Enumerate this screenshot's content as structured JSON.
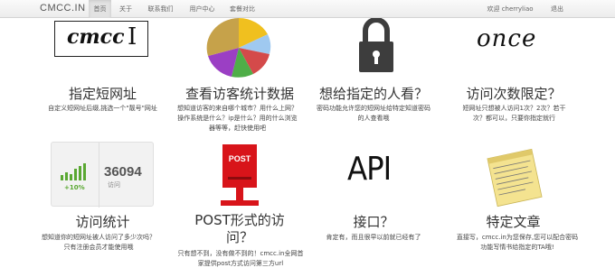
{
  "navbar": {
    "brand": "CMCC.IN",
    "items": [
      "首页",
      "关于",
      "联系我们",
      "用户中心",
      "套餐对比"
    ],
    "welcome": "欢迎 cherryliao",
    "logout": "退出"
  },
  "features": [
    {
      "title": "指定短网址",
      "desc": "自定义短网址后缀,挑选一个\"靓号\"网址"
    },
    {
      "title": "查看访客统计数据",
      "desc": "想知道访客的来自哪个城市？用什么上网？操作系统是什么？ip是什么？用的什么浏览器等等，赶快使用吧"
    },
    {
      "title": "想给指定的人看？",
      "desc": "密码功能允许您的短网址给特定知道密码的人查看哦"
    },
    {
      "title": "访问次数限定？",
      "desc": "短网址只想被人访问1次？2次？若干次？都可以，只要你指定就行"
    },
    {
      "title": "访问统计",
      "desc": "想知道你的短网址被人访问了多少次吗？只有注册会员才能使用哦"
    },
    {
      "title": "POST形式的访问？",
      "desc": "只有想不到，没有做不到的！cmcc.in全网首家提供post方式访问第三方url"
    },
    {
      "title": "接口？",
      "desc": "肯定有，而且很早以前就已经有了"
    },
    {
      "title": "特定文章",
      "desc": "直接写，cmcc.in为您保存,您可以配合密码功能写情书给指定的TA哦!"
    }
  ],
  "icons": {
    "cmcc_text": "cmcc",
    "once_text": "once",
    "stats_number": "36094",
    "stats_label": "访问",
    "stats_change": "+10%",
    "post_label": "POST",
    "api_label": "API"
  },
  "names": [
    "cmcc-logo-icon",
    "pie-chart-icon",
    "padlock-icon",
    "once-text-icon",
    "stats-widget-icon",
    "post-mailbox-icon",
    "api-text-icon",
    "sticky-note-icon"
  ]
}
